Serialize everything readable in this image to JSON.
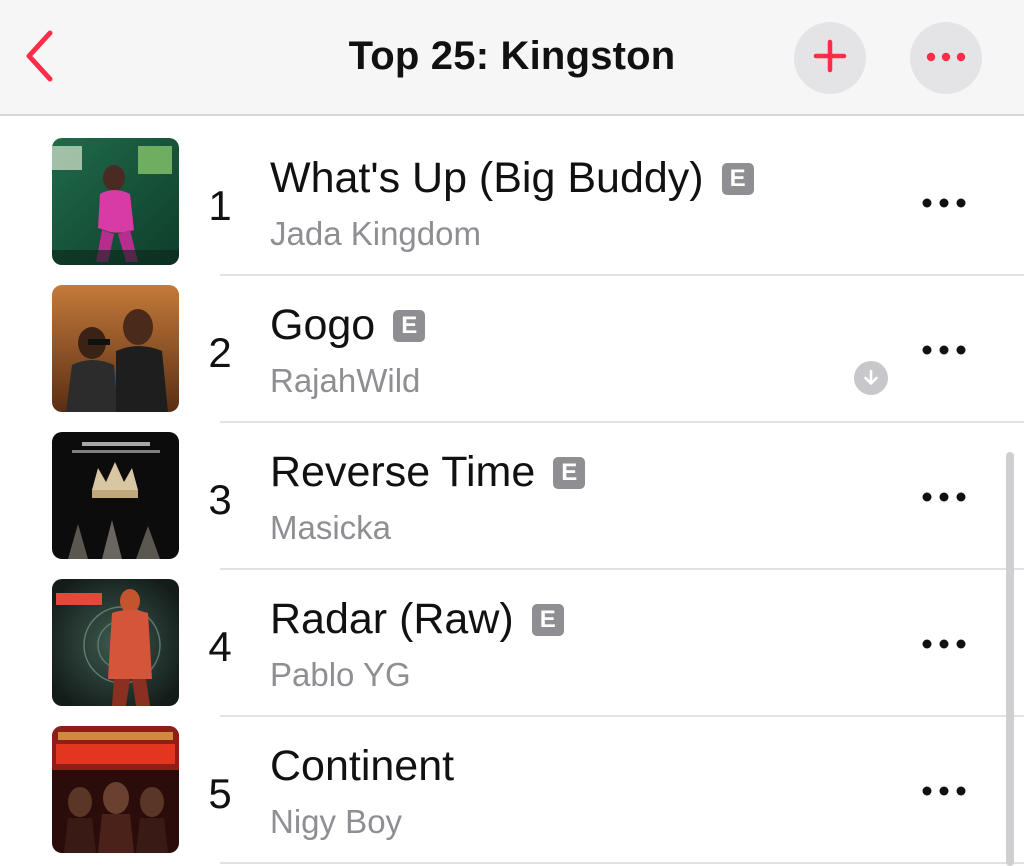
{
  "header": {
    "title": "Top 25: Kingston",
    "back_icon": "chevron-left-icon",
    "add_icon": "plus-icon",
    "more_icon": "ellipsis-icon"
  },
  "colors": {
    "accent": "#fa2d48",
    "explicit_badge": "#8e8e93",
    "secondary_text": "#8e8e93"
  },
  "explicit_label": "E",
  "tracks": [
    {
      "rank": "1",
      "title": "What's Up (Big Buddy)",
      "artist": "Jada Kingdom",
      "explicit": true
    },
    {
      "rank": "2",
      "title": "Gogo",
      "artist": "RajahWild",
      "explicit": true
    },
    {
      "rank": "3",
      "title": "Reverse Time",
      "artist": "Masicka",
      "explicit": true,
      "downloaded": true
    },
    {
      "rank": "4",
      "title": "Radar (Raw)",
      "artist": "Pablo YG",
      "explicit": true
    },
    {
      "rank": "5",
      "title": "Continent",
      "artist": "Nigy Boy",
      "explicit": false
    }
  ]
}
